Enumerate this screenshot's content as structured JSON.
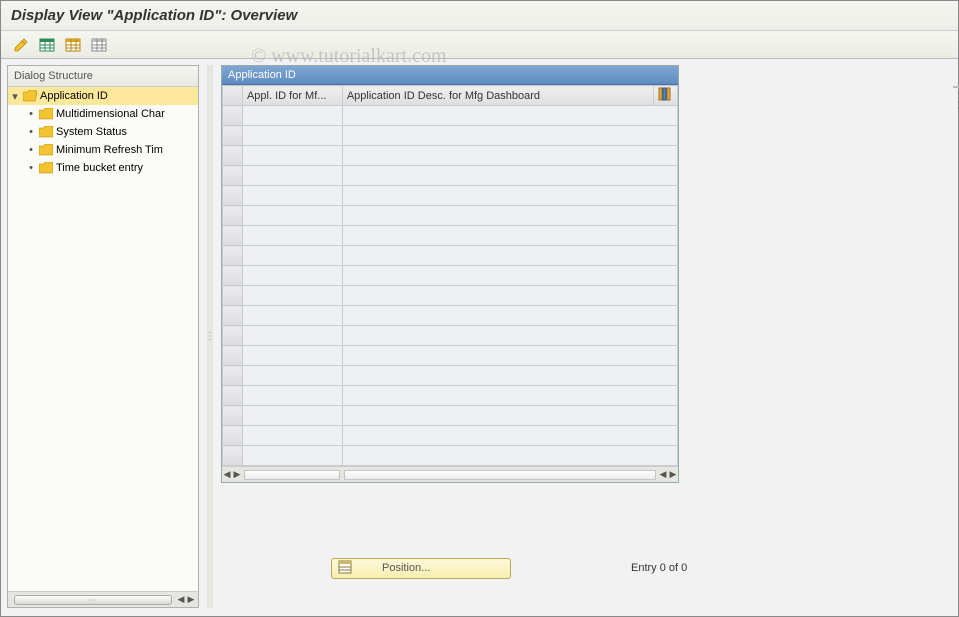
{
  "title": "Display View \"Application ID\": Overview",
  "watermark": "© www.tutorialkart.com",
  "sidebar": {
    "header": "Dialog Structure",
    "root": {
      "label": "Application ID",
      "expanded": true
    },
    "items": [
      {
        "label": "Multidimensional Char"
      },
      {
        "label": "System Status"
      },
      {
        "label": "Minimum Refresh Tim"
      },
      {
        "label": "Time bucket entry"
      }
    ]
  },
  "grid": {
    "title": "Application ID",
    "columns": {
      "col1": "Appl. ID for Mf...",
      "col2": "Application ID Desc. for Mfg Dashboard"
    },
    "row_count": 18
  },
  "footer": {
    "position_label": "Position...",
    "entry_text": "Entry 0 of 0"
  },
  "icons": {
    "pencil": "pencil-icon",
    "table_green": "table-green-icon",
    "table_yellow": "table-yellow-icon",
    "table_plain": "table-plain-icon",
    "config": "config-columns-icon"
  }
}
